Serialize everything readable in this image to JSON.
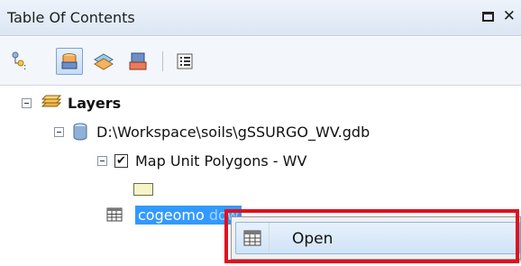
{
  "window": {
    "title": "Table Of Contents"
  },
  "toolbar": {
    "buttons": [
      {
        "icon": "list-by-drawing-order-icon"
      },
      {
        "icon": "list-by-source-icon",
        "active": true
      },
      {
        "icon": "list-by-visibility-icon"
      },
      {
        "icon": "list-by-selection-icon"
      },
      {
        "icon": "options-icon"
      }
    ]
  },
  "tree": {
    "layers_label": "Layers",
    "database_label": "D:\\Workspace\\soils\\gSSURGO_WV.gdb",
    "layer_label": "Map Unit Polygons - WV",
    "layer_checked": true,
    "swatch_color": "#f6f5c7",
    "table_label_visible": "cogeomo",
    "table_label_partial": "dow"
  },
  "context_menu": {
    "items": [
      {
        "label": "Open",
        "icon": "table-icon",
        "hovered": true
      }
    ],
    "highlight_color": "#e0101e"
  },
  "colors": {
    "selection": "#3399ff",
    "title_bar": "#dbe6f4"
  }
}
